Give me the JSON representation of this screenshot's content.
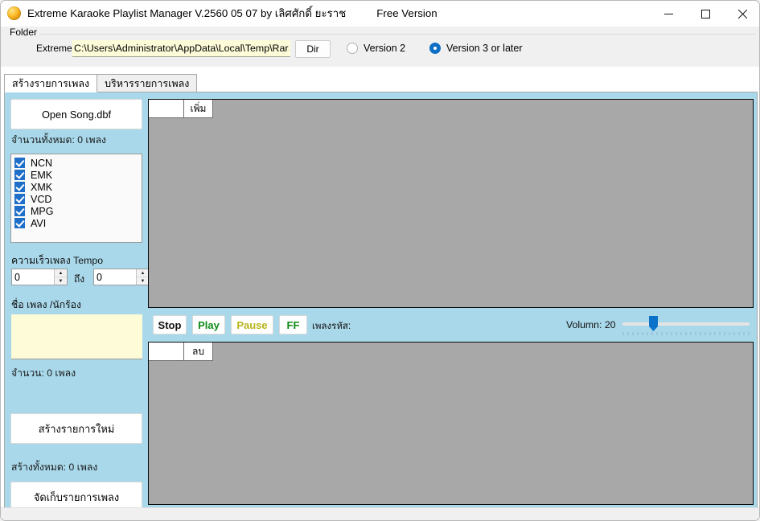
{
  "window": {
    "title": "Extreme Karaoke Playlist Manager V.2560 05 07  by เลิศศักดิ์ ยะราช",
    "edition": "Free Version",
    "icon": "orange-sphere-icon",
    "minimize_label": "minimize-icon",
    "maximize_label": "maximize-icon",
    "close_label": "close-icon"
  },
  "folder_group": {
    "legend": "Folder",
    "extreme_label": "Extreme",
    "path_value": "C:\\Users\\Administrator\\AppData\\Local\\Temp\\Rar$EXa",
    "path_placeholder": "",
    "dir_button": "Dir",
    "version2_label": "Version 2",
    "version3_label": "Version 3 or later",
    "version_selected": "Version 3 or later"
  },
  "tabs": [
    {
      "label": "สร้างรายการเพลง",
      "active": true
    },
    {
      "label": "บริหารรายการเพลง",
      "active": false
    }
  ],
  "left_panel": {
    "open_song_button": "Open Song.dbf",
    "total_label": "จำนวนทั้งหมด: 0 เพลง",
    "formats": [
      {
        "label": "NCN",
        "checked": true
      },
      {
        "label": "EMK",
        "checked": true
      },
      {
        "label": "XMK",
        "checked": true
      },
      {
        "label": "VCD",
        "checked": true
      },
      {
        "label": "MPG",
        "checked": true
      },
      {
        "label": "AVI",
        "checked": true
      }
    ],
    "tempo_label": "ความเร็วเพลง  Tempo",
    "tempo_from": "0",
    "tempo_to": "0",
    "thueng_label": "ถึง",
    "song_name_label": "ชื่อ เพลง /นักร้อง",
    "song_name_value": "",
    "song_name_placeholder": "",
    "count_label": "จำนวน: 0 เพลง",
    "new_list_button": "สร้างรายการใหม่",
    "created_total_label": "สร้างทั้งหมด: 0 เพลง",
    "save_list_button": "จัดเก็บรายการเพลง"
  },
  "top_grid": {
    "columns": [
      "",
      "เพิ่ม"
    ],
    "rows": []
  },
  "bottom_grid": {
    "columns": [
      "",
      "ลบ"
    ],
    "rows": []
  },
  "transport": {
    "stop": "Stop",
    "play": "Play",
    "pause": "Pause",
    "ff": "FF",
    "song_code_label": "เพลงรหัส:",
    "song_code_value": "",
    "volume_label": "Volumn: 20",
    "volume_value": 20
  },
  "colors": {
    "panel_bg": "#a9d8ea",
    "grid_bg": "#a8a8a8",
    "field_yellow": "#fdfbd8",
    "accent_blue": "#0e6fc4",
    "play_green": "#0f8a17",
    "pause_olive": "#b7b41a"
  }
}
